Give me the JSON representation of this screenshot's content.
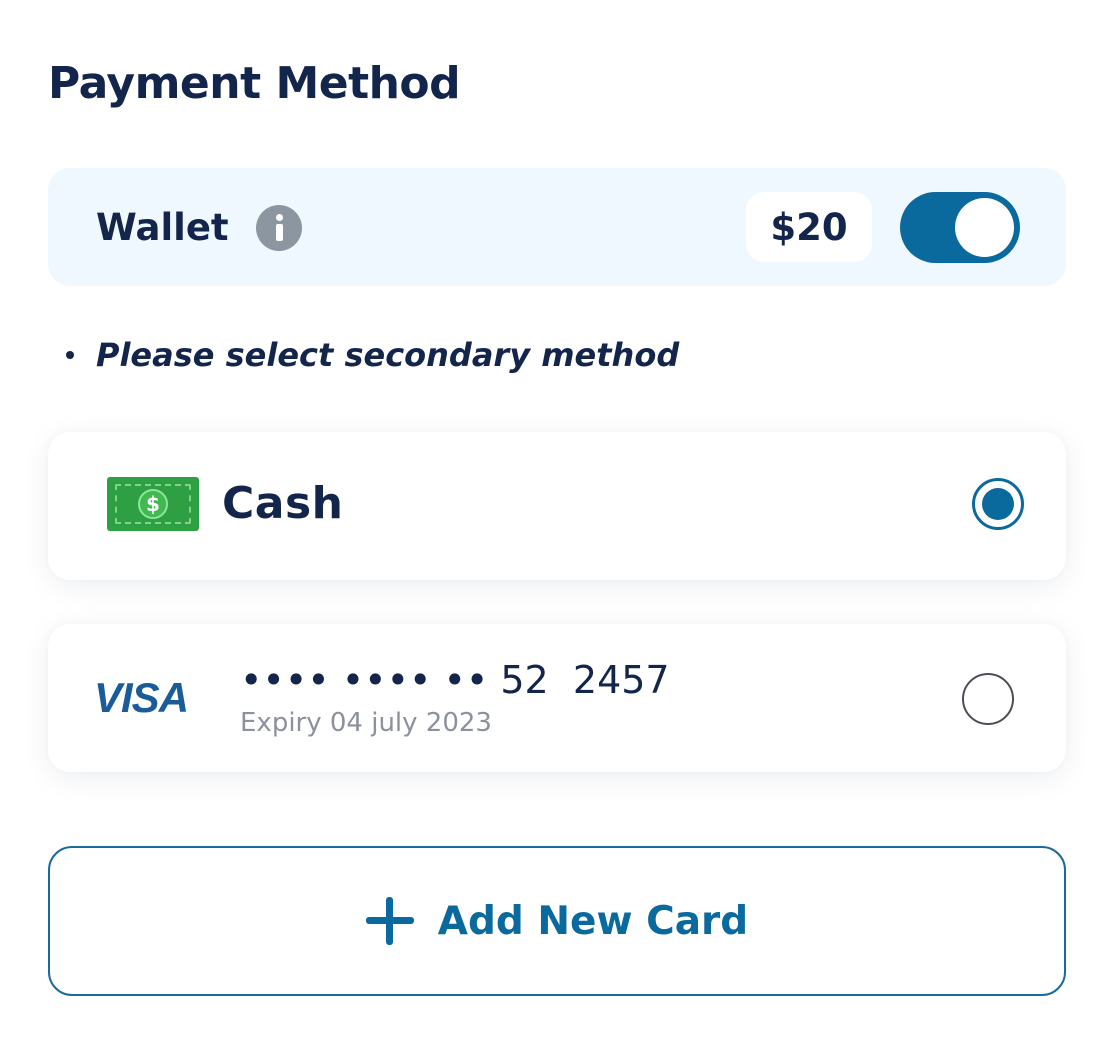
{
  "header": {
    "title": "Payment Method"
  },
  "wallet": {
    "label": "Wallet",
    "info_icon": "info-icon",
    "balance": "$20",
    "toggle_on": true
  },
  "hint": {
    "text": "Please select secondary method"
  },
  "options": {
    "cash": {
      "label": "Cash",
      "icon": "cash-bill-icon",
      "icon_symbol": "$",
      "selected": true
    },
    "visa": {
      "brand": "VISA",
      "number": "•••• •••• •• 52  2457",
      "expiry": "Expiry 04 july 2023",
      "selected": false
    }
  },
  "add_card": {
    "label": "Add New Card",
    "icon": "plus-icon"
  },
  "colors": {
    "primary": "#0b6a9d",
    "text": "#13254a",
    "wallet_bg": "#eef8fe",
    "cash_green": "#2ea043",
    "visa_blue": "#1a5c9a",
    "muted": "#8c929c"
  }
}
